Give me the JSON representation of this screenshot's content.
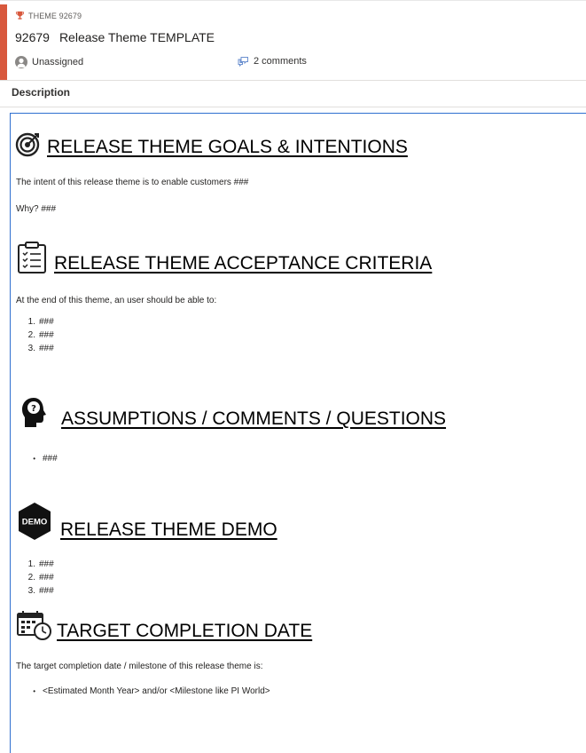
{
  "header": {
    "type_label": "THEME 92679",
    "id": "92679",
    "title": "Release Theme TEMPLATE",
    "assignee": "Unassigned",
    "comments": "2 comments",
    "accent_color": "#d8583d"
  },
  "description_label": "Description",
  "sections": {
    "goals": {
      "icon": "target-icon",
      "heading": "RELEASE THEME GOALS & INTENTIONS",
      "paragraphs": [
        "The intent of this release theme is to enable customers ###",
        "Why? ###"
      ]
    },
    "acceptance": {
      "icon": "clipboard-checklist-icon",
      "heading": "RELEASE THEME ACCEPTANCE CRITERIA",
      "intro": "At the end of this theme, an user should be able to:",
      "items": [
        {
          "marker": "1.",
          "text": "###"
        },
        {
          "marker": "2.",
          "text": "###"
        },
        {
          "marker": "3.",
          "text": "###"
        }
      ]
    },
    "assumptions": {
      "icon": "head-question-icon",
      "heading": "ASSUMPTIONS / COMMENTS / QUESTIONS",
      "items": [
        {
          "marker": "•",
          "text": "###"
        }
      ]
    },
    "demo": {
      "icon": "demo-badge-icon",
      "badge_text": "DEMO",
      "heading": "RELEASE THEME DEMO",
      "items": [
        {
          "marker": "1.",
          "text": "###"
        },
        {
          "marker": "2.",
          "text": "###"
        },
        {
          "marker": "3.",
          "text": "###"
        }
      ]
    },
    "target": {
      "icon": "calendar-clock-icon",
      "heading": "TARGET COMPLETION DATE",
      "intro": "The target completion date / milestone of this release theme is:",
      "items": [
        {
          "marker": "•",
          "text": "<Estimated Month Year> and/or <Milestone like PI World>"
        }
      ]
    }
  }
}
